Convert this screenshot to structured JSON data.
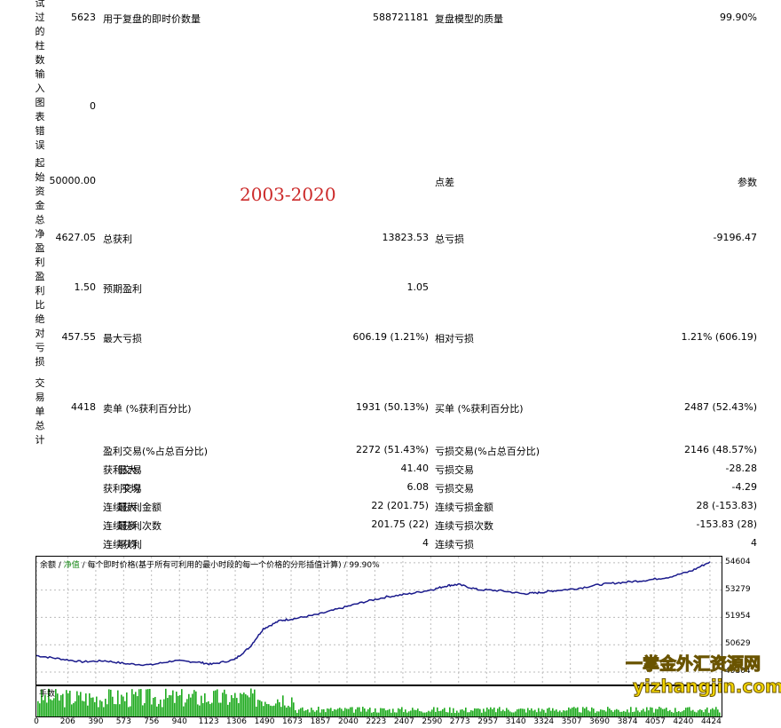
{
  "left_labels": [
    "试过的柱数",
    "输入图表错误",
    "起始资金",
    "总净盈利",
    "盈利比",
    "绝对亏损",
    "交易单总计"
  ],
  "rows": {
    "bars": {
      "value": "5623",
      "label1": "用于复盘的即时价数量",
      "value1": "588721181",
      "label2": "复盘模型的质量",
      "value2": "99.90%"
    },
    "errors": {
      "value": "0"
    },
    "capital": {
      "value": "50000.00",
      "label2": "点差",
      "value2": "参数"
    },
    "net": {
      "value": "4627.05",
      "label1": "总获利",
      "value1": "13823.53",
      "label2": "总亏损",
      "value2": "-9196.47"
    },
    "pf": {
      "value": "1.50",
      "label1": "预期盈利",
      "value1": "1.05"
    },
    "dd": {
      "value": "457.55",
      "label1": "最大亏损",
      "value1": "606.19 (1.21%)",
      "label2": "相对亏损",
      "value2": "1.21% (606.19)"
    },
    "trades": {
      "value": "4418",
      "label1": "卖单 (%获利百分比)",
      "value1": "1931 (50.13%)",
      "label2": "买单 (%获利百分比)",
      "value2": "2487 (52.43%)"
    }
  },
  "range_title": "2003-2020",
  "stats": [
    {
      "prefix": "",
      "label1": "盈利交易(%占总百分比)",
      "value1": "2272 (51.43%)",
      "label2": "亏损交易(%占总百分比)",
      "value2": "2146 (48.57%)"
    },
    {
      "prefix": "最大:",
      "label1": "获利交易",
      "value1": "41.40",
      "label2": "亏损交易",
      "value2": "-28.28"
    },
    {
      "prefix": "平均",
      "label1": "获利交易",
      "value1": "6.08",
      "label2": "亏损交易",
      "value2": "-4.29"
    },
    {
      "prefix": "最大:",
      "label1": "连续获利金额",
      "value1": "22 (201.75)",
      "label2": "连续亏损金额",
      "value2": "28 (-153.83)"
    },
    {
      "prefix": "最多:",
      "label1": "连续获利次数",
      "value1": "201.75 (22)",
      "label2": "连续亏损次数",
      "value2": "-153.83 (28)"
    },
    {
      "prefix": "平均:",
      "label1": "连续获利",
      "value1": "4",
      "label2": "连续亏损",
      "value2": "4"
    }
  ],
  "chart_header": {
    "balance": "余额",
    "sep1": " / ",
    "equity": "净值",
    "rest": " / 每个即时价格(基于所有可利用的最小时段的每一个价格的分形插值计算) / 99.90%"
  },
  "volume_label": "手数",
  "watermark": {
    "line1": "一掌金外汇资源网",
    "line2": "yizhangjin.com"
  },
  "chart_data": {
    "type": "line",
    "y_ticks": [
      "54604",
      "53279",
      "51954",
      "50629",
      "49304"
    ],
    "x_ticks": [
      "0",
      "206",
      "390",
      "573",
      "756",
      "940",
      "1123",
      "1306",
      "1490",
      "1673",
      "1857",
      "2040",
      "2223",
      "2407",
      "2590",
      "2773",
      "2957",
      "3140",
      "3324",
      "3507",
      "3690",
      "3874",
      "4057",
      "4240",
      "4424"
    ],
    "ylim": [
      48700,
      54900
    ],
    "xlim": [
      0,
      4500
    ],
    "series": [
      {
        "color": "#1a1a8c",
        "x": [
          0,
          150,
          300,
          450,
          600,
          750,
          900,
          1050,
          1150,
          1300,
          1400,
          1490,
          1600,
          1700,
          1850,
          2000,
          2150,
          2300,
          2450,
          2600,
          2700,
          2773,
          2900,
          3050,
          3200,
          3300,
          3400,
          3550,
          3700,
          3850,
          4000,
          4150,
          4300,
          4424
        ],
        "y": [
          50100,
          49950,
          49800,
          49850,
          49700,
          49650,
          49850,
          49800,
          49680,
          49900,
          50500,
          51400,
          51800,
          51900,
          52100,
          52400,
          52700,
          52950,
          53100,
          53300,
          53500,
          53550,
          53300,
          53250,
          53100,
          53150,
          53250,
          53350,
          53550,
          53650,
          53750,
          53900,
          54200,
          54650
        ]
      }
    ]
  }
}
